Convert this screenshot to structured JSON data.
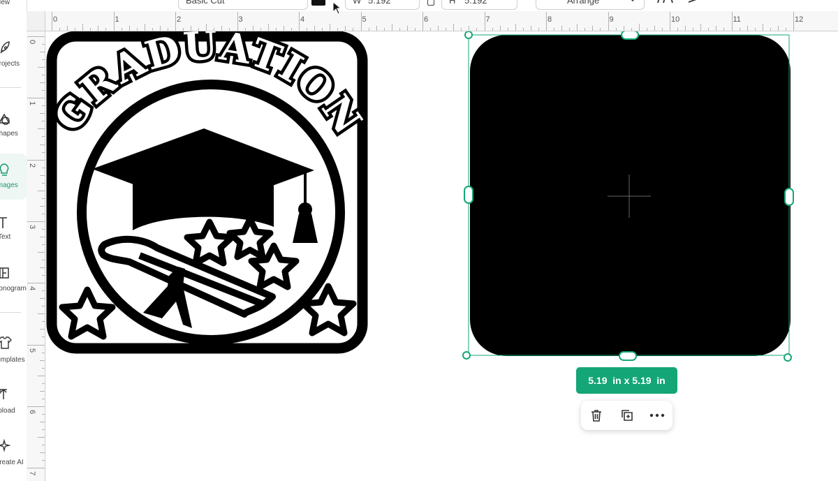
{
  "toolbar": {
    "operation_label": "Basic Cut",
    "width_label": "W",
    "width_value": "5.192",
    "height_label": "H",
    "height_value": "5.192",
    "arrange_label": "Arrange"
  },
  "sidebar": {
    "items": [
      {
        "label": "New",
        "icon": "new-icon"
      },
      {
        "label": "Projects",
        "icon": "rocket-icon"
      },
      {
        "label": "Shapes",
        "icon": "shapes-icon"
      },
      {
        "label": "Images",
        "icon": "lightbulb-icon"
      },
      {
        "label": "Text",
        "icon": "text-icon"
      },
      {
        "label": "Monogram",
        "icon": "monogram-icon"
      },
      {
        "label": "Templates",
        "icon": "shirt-icon"
      },
      {
        "label": "Upload",
        "icon": "upload-icon"
      },
      {
        "label": "Create AI",
        "icon": "sparkle-icon"
      }
    ]
  },
  "ruler": {
    "top_numbers": [
      "0",
      "1",
      "2",
      "3",
      "4",
      "5",
      "6",
      "7",
      "8",
      "9",
      "10",
      "11",
      "12"
    ],
    "left_numbers": [
      "0",
      "1",
      "2",
      "3",
      "4",
      "5",
      "6",
      "7"
    ]
  },
  "design": {
    "title_text": "GRADUATION"
  },
  "selection": {
    "size_label": "5.19  in x 5.19  in",
    "accent_color": "#14a676"
  },
  "actions": {
    "delete_icon": "trash-icon",
    "duplicate_icon": "duplicate-icon",
    "more_icon": "more-icon"
  }
}
